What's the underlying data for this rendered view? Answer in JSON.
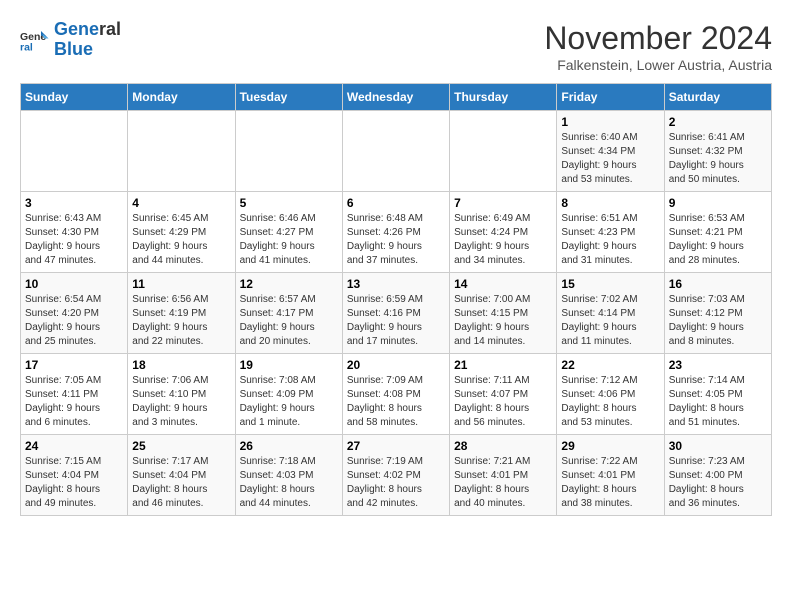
{
  "logo": {
    "line1": "General",
    "line2": "Blue"
  },
  "title": "November 2024",
  "location": "Falkenstein, Lower Austria, Austria",
  "weekdays": [
    "Sunday",
    "Monday",
    "Tuesday",
    "Wednesday",
    "Thursday",
    "Friday",
    "Saturday"
  ],
  "weeks": [
    [
      {
        "day": "",
        "info": ""
      },
      {
        "day": "",
        "info": ""
      },
      {
        "day": "",
        "info": ""
      },
      {
        "day": "",
        "info": ""
      },
      {
        "day": "",
        "info": ""
      },
      {
        "day": "1",
        "info": "Sunrise: 6:40 AM\nSunset: 4:34 PM\nDaylight: 9 hours\nand 53 minutes."
      },
      {
        "day": "2",
        "info": "Sunrise: 6:41 AM\nSunset: 4:32 PM\nDaylight: 9 hours\nand 50 minutes."
      }
    ],
    [
      {
        "day": "3",
        "info": "Sunrise: 6:43 AM\nSunset: 4:30 PM\nDaylight: 9 hours\nand 47 minutes."
      },
      {
        "day": "4",
        "info": "Sunrise: 6:45 AM\nSunset: 4:29 PM\nDaylight: 9 hours\nand 44 minutes."
      },
      {
        "day": "5",
        "info": "Sunrise: 6:46 AM\nSunset: 4:27 PM\nDaylight: 9 hours\nand 41 minutes."
      },
      {
        "day": "6",
        "info": "Sunrise: 6:48 AM\nSunset: 4:26 PM\nDaylight: 9 hours\nand 37 minutes."
      },
      {
        "day": "7",
        "info": "Sunrise: 6:49 AM\nSunset: 4:24 PM\nDaylight: 9 hours\nand 34 minutes."
      },
      {
        "day": "8",
        "info": "Sunrise: 6:51 AM\nSunset: 4:23 PM\nDaylight: 9 hours\nand 31 minutes."
      },
      {
        "day": "9",
        "info": "Sunrise: 6:53 AM\nSunset: 4:21 PM\nDaylight: 9 hours\nand 28 minutes."
      }
    ],
    [
      {
        "day": "10",
        "info": "Sunrise: 6:54 AM\nSunset: 4:20 PM\nDaylight: 9 hours\nand 25 minutes."
      },
      {
        "day": "11",
        "info": "Sunrise: 6:56 AM\nSunset: 4:19 PM\nDaylight: 9 hours\nand 22 minutes."
      },
      {
        "day": "12",
        "info": "Sunrise: 6:57 AM\nSunset: 4:17 PM\nDaylight: 9 hours\nand 20 minutes."
      },
      {
        "day": "13",
        "info": "Sunrise: 6:59 AM\nSunset: 4:16 PM\nDaylight: 9 hours\nand 17 minutes."
      },
      {
        "day": "14",
        "info": "Sunrise: 7:00 AM\nSunset: 4:15 PM\nDaylight: 9 hours\nand 14 minutes."
      },
      {
        "day": "15",
        "info": "Sunrise: 7:02 AM\nSunset: 4:14 PM\nDaylight: 9 hours\nand 11 minutes."
      },
      {
        "day": "16",
        "info": "Sunrise: 7:03 AM\nSunset: 4:12 PM\nDaylight: 9 hours\nand 8 minutes."
      }
    ],
    [
      {
        "day": "17",
        "info": "Sunrise: 7:05 AM\nSunset: 4:11 PM\nDaylight: 9 hours\nand 6 minutes."
      },
      {
        "day": "18",
        "info": "Sunrise: 7:06 AM\nSunset: 4:10 PM\nDaylight: 9 hours\nand 3 minutes."
      },
      {
        "day": "19",
        "info": "Sunrise: 7:08 AM\nSunset: 4:09 PM\nDaylight: 9 hours\nand 1 minute."
      },
      {
        "day": "20",
        "info": "Sunrise: 7:09 AM\nSunset: 4:08 PM\nDaylight: 8 hours\nand 58 minutes."
      },
      {
        "day": "21",
        "info": "Sunrise: 7:11 AM\nSunset: 4:07 PM\nDaylight: 8 hours\nand 56 minutes."
      },
      {
        "day": "22",
        "info": "Sunrise: 7:12 AM\nSunset: 4:06 PM\nDaylight: 8 hours\nand 53 minutes."
      },
      {
        "day": "23",
        "info": "Sunrise: 7:14 AM\nSunset: 4:05 PM\nDaylight: 8 hours\nand 51 minutes."
      }
    ],
    [
      {
        "day": "24",
        "info": "Sunrise: 7:15 AM\nSunset: 4:04 PM\nDaylight: 8 hours\nand 49 minutes."
      },
      {
        "day": "25",
        "info": "Sunrise: 7:17 AM\nSunset: 4:04 PM\nDaylight: 8 hours\nand 46 minutes."
      },
      {
        "day": "26",
        "info": "Sunrise: 7:18 AM\nSunset: 4:03 PM\nDaylight: 8 hours\nand 44 minutes."
      },
      {
        "day": "27",
        "info": "Sunrise: 7:19 AM\nSunset: 4:02 PM\nDaylight: 8 hours\nand 42 minutes."
      },
      {
        "day": "28",
        "info": "Sunrise: 7:21 AM\nSunset: 4:01 PM\nDaylight: 8 hours\nand 40 minutes."
      },
      {
        "day": "29",
        "info": "Sunrise: 7:22 AM\nSunset: 4:01 PM\nDaylight: 8 hours\nand 38 minutes."
      },
      {
        "day": "30",
        "info": "Sunrise: 7:23 AM\nSunset: 4:00 PM\nDaylight: 8 hours\nand 36 minutes."
      }
    ]
  ]
}
